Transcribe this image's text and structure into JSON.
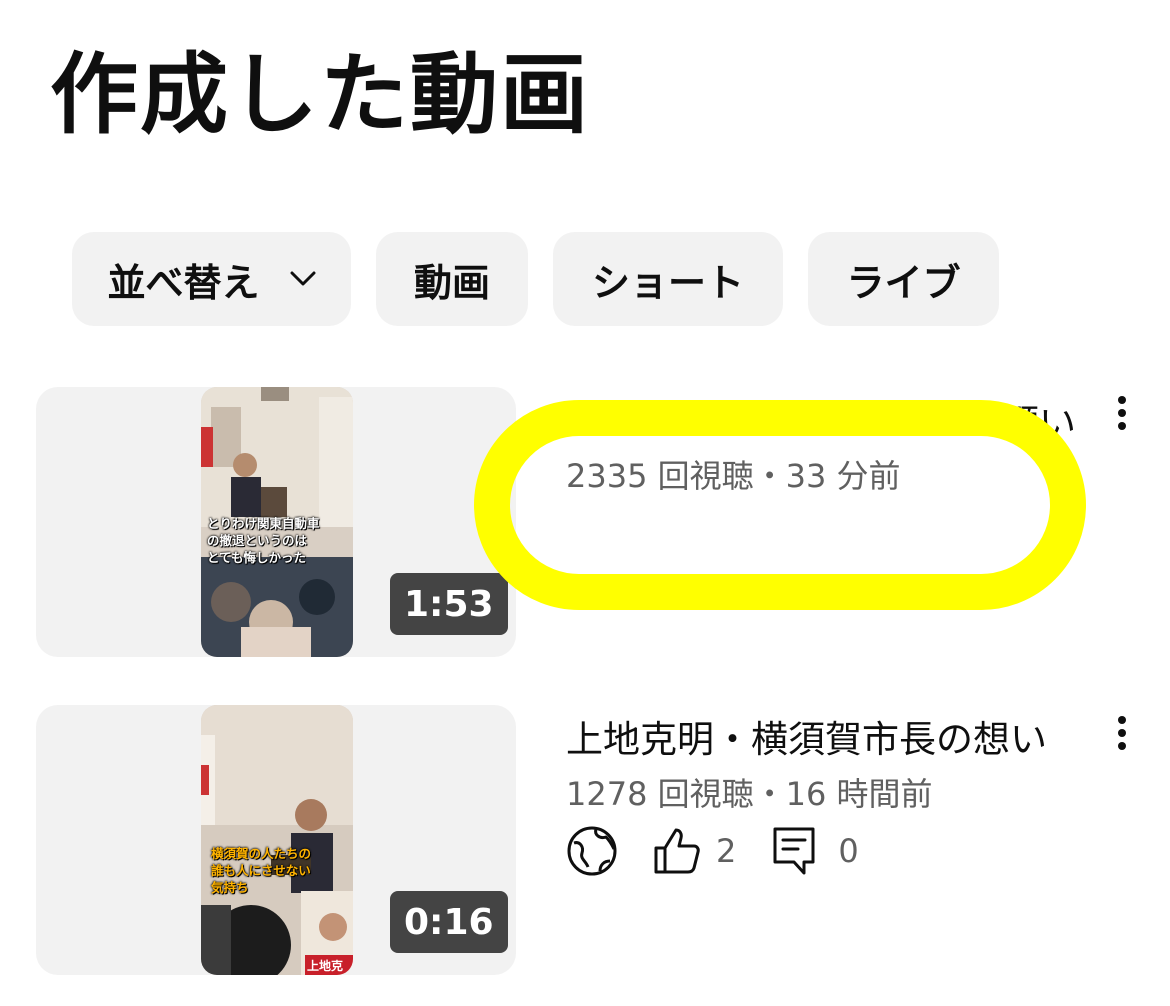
{
  "page": {
    "title": "作成した動画"
  },
  "chips": [
    {
      "label": "並べ替え",
      "icon": "chevron-down-icon"
    },
    {
      "label": "動画"
    },
    {
      "label": "ショート"
    },
    {
      "label": "ライブ"
    }
  ],
  "videos": [
    {
      "title_visible_fragment": "願い",
      "views_time": "2335 回視聴・33 分前",
      "duration": "1:53",
      "caption_lines": [
        "とりわけ関東自動車",
        "の撤退というのは",
        "とても悔しかった"
      ]
    },
    {
      "title": "上地克明・横須賀市長の想い",
      "views_time": "1278 回視聴・16 時間前",
      "duration": "0:16",
      "likes": "2",
      "comments": "0",
      "caption_lines": [
        "横須賀の人たちの",
        "誰も人にさせない",
        "気持ち"
      ],
      "poster_text": "上地克"
    }
  ],
  "colors": {
    "highlight": "#ffff00",
    "chip_bg": "#f2f2f2",
    "meta_text": "#606060",
    "caption_text": "#ffb300"
  }
}
